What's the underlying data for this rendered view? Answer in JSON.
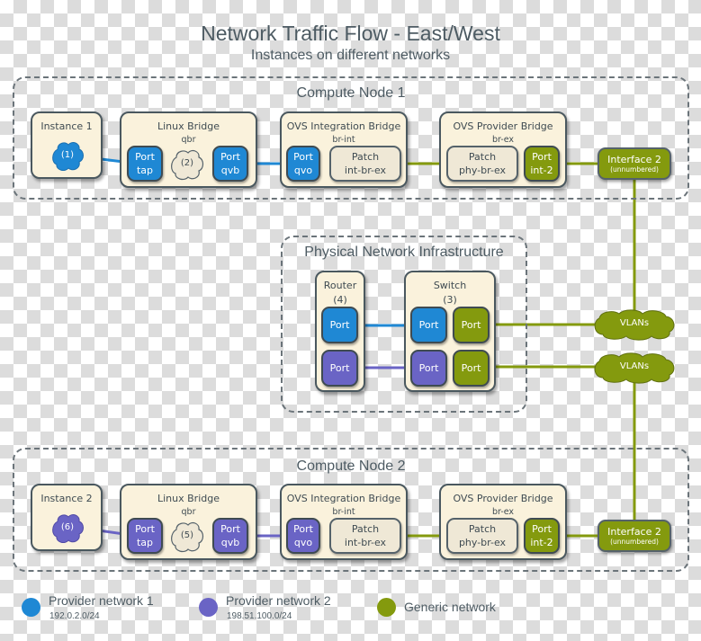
{
  "title": "Network Traffic Flow - East/West",
  "subtitle": "Instances on different networks",
  "colors": {
    "provider1": "#1f88d4",
    "provider2": "#6a64c5",
    "generic": "#849a0e",
    "box_fill": "#faf2dc",
    "border": "#4a585f"
  },
  "compute_node_1": {
    "label": "Compute Node 1",
    "instance": {
      "title": "Instance 1",
      "cloud": "(1)"
    },
    "linux_bridge": {
      "title": "Linux Bridge",
      "sub": "qbr",
      "port_tap": {
        "line1": "Port",
        "line2": "tap"
      },
      "cloud": "(2)",
      "port_qvb": {
        "line1": "Port",
        "line2": "qvb"
      }
    },
    "ovs_int": {
      "title": "OVS Integration Bridge",
      "sub": "br-int",
      "port_qvo": {
        "line1": "Port",
        "line2": "qvo"
      },
      "patch": {
        "line1": "Patch",
        "line2": "int-br-ex"
      }
    },
    "ovs_prov": {
      "title": "OVS Provider Bridge",
      "sub": "br-ex",
      "patch": {
        "line1": "Patch",
        "line2": "phy-br-ex"
      },
      "port_int": {
        "line1": "Port",
        "line2": "int-2"
      }
    },
    "interface": {
      "line1": "Interface 2",
      "line2": "(unnumbered)"
    }
  },
  "physical": {
    "label": "Physical Network Infrastructure",
    "router": {
      "title": "Router",
      "sub": "(4)",
      "port1": "Port",
      "port2": "Port"
    },
    "switch": {
      "title": "Switch",
      "sub": "(3)",
      "port1": "Port",
      "port2": "Port",
      "port3": "Port",
      "port4": "Port"
    },
    "vlan1": "VLANs",
    "vlan2": "VLANs"
  },
  "compute_node_2": {
    "label": "Compute Node 2",
    "instance": {
      "title": "Instance 2",
      "cloud": "(6)"
    },
    "linux_bridge": {
      "title": "Linux Bridge",
      "sub": "qbr",
      "port_tap": {
        "line1": "Port",
        "line2": "tap"
      },
      "cloud": "(5)",
      "port_qvb": {
        "line1": "Port",
        "line2": "qvb"
      }
    },
    "ovs_int": {
      "title": "OVS Integration Bridge",
      "sub": "br-int",
      "port_qvo": {
        "line1": "Port",
        "line2": "qvo"
      },
      "patch": {
        "line1": "Patch",
        "line2": "int-br-ex"
      }
    },
    "ovs_prov": {
      "title": "OVS Provider Bridge",
      "sub": "br-ex",
      "patch": {
        "line1": "Patch",
        "line2": "phy-br-ex"
      },
      "port_int": {
        "line1": "Port",
        "line2": "int-2"
      }
    },
    "interface": {
      "line1": "Interface 2",
      "line2": "(unnumbered)"
    }
  },
  "legend": [
    {
      "name": "Provider network 1",
      "cidr": "192.0.2.0/24",
      "color": "#1f88d4"
    },
    {
      "name": "Provider network 2",
      "cidr": "198.51.100.0/24",
      "color": "#6a64c5"
    },
    {
      "name": "Generic network",
      "cidr": "",
      "color": "#849a0e"
    }
  ]
}
